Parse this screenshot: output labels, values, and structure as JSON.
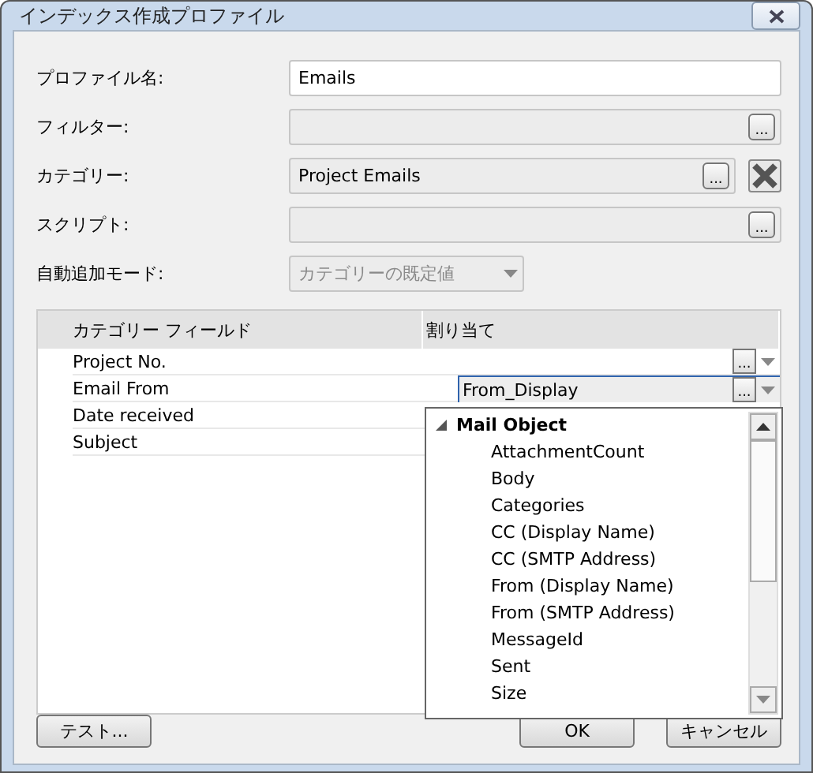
{
  "window": {
    "title": "インデックス作成プロファイル"
  },
  "form": [
    {
      "kind": "text",
      "label": "プロファイル名:",
      "value": "Emails"
    },
    {
      "kind": "browse",
      "label": "フィルター:",
      "button": "..."
    },
    {
      "kind": "browse_clear",
      "label": "カテゴリー:",
      "value": "Project Emails",
      "button": "..."
    },
    {
      "kind": "browse",
      "label": "スクリプト:",
      "button": "..."
    },
    {
      "kind": "dropdown",
      "label": "自動追加モード:",
      "value": "カテゴリーの既定値",
      "disabled": true
    }
  ],
  "grid": {
    "columns": [
      "カテゴリー フィールド",
      "割り当て"
    ],
    "rows": [
      {
        "field": "Project No.",
        "button": "...",
        "selected": false
      },
      {
        "field": "Email From",
        "assignment": "From_Display",
        "button": "...",
        "selected": true
      },
      {
        "field": "Date received",
        "selected": false
      },
      {
        "field": "Subject",
        "selected": false
      }
    ]
  },
  "popup": {
    "group": "Mail Object",
    "expanded": true,
    "items": [
      "AttachmentCount",
      "Body",
      "Categories",
      "CC (Display Name)",
      "CC (SMTP Address)",
      "From (Display Name)",
      "From (SMTP Address)",
      "MessageId",
      "Sent",
      "Size"
    ]
  },
  "buttons": {
    "test": "テスト...",
    "ok": "OK",
    "cancel": "キャンセル"
  }
}
